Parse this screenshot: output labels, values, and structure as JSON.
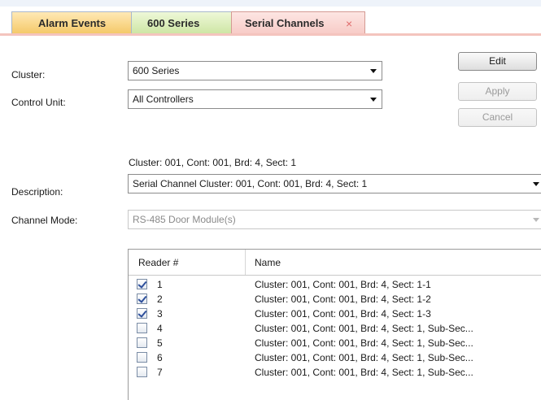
{
  "tabs": [
    {
      "label": "Alarm Events"
    },
    {
      "label": "600 Series"
    },
    {
      "label": "Serial Channels",
      "close": "×"
    }
  ],
  "form": {
    "cluster_label": "Cluster:",
    "cluster_value": "600 Series",
    "control_unit_label": "Control Unit:",
    "control_unit_value": "All Controllers",
    "location_text": "Cluster: 001, Cont: 001, Brd: 4, Sect: 1",
    "description_label": "Description:",
    "description_value": "Serial Channel Cluster: 001, Cont: 001, Brd: 4, Sect: 1",
    "channel_mode_label": "Channel Mode:",
    "channel_mode_value": "RS-485 Door Module(s)"
  },
  "buttons": {
    "edit": "Edit",
    "apply": "Apply",
    "cancel": "Cancel"
  },
  "grid": {
    "columns": [
      "Reader #",
      "Name"
    ],
    "rows": [
      {
        "reader": "1",
        "name": "Cluster: 001, Cont: 001, Brd: 4, Sect: 1-1",
        "checked": true
      },
      {
        "reader": "2",
        "name": "Cluster: 001, Cont: 001, Brd: 4, Sect: 1-2",
        "checked": true
      },
      {
        "reader": "3",
        "name": "Cluster: 001, Cont: 001, Brd: 4, Sect: 1-3",
        "checked": true
      },
      {
        "reader": "4",
        "name": "Cluster: 001, Cont: 001, Brd: 4, Sect: 1, Sub-Sec...",
        "checked": false
      },
      {
        "reader": "5",
        "name": "Cluster: 001, Cont: 001, Brd: 4, Sect: 1, Sub-Sec...",
        "checked": false
      },
      {
        "reader": "6",
        "name": "Cluster: 001, Cont: 001, Brd: 4, Sect: 1, Sub-Sec...",
        "checked": false
      },
      {
        "reader": "7",
        "name": "Cluster: 001, Cont: 001, Brd: 4, Sect: 1, Sub-Sec...",
        "checked": false
      }
    ]
  }
}
